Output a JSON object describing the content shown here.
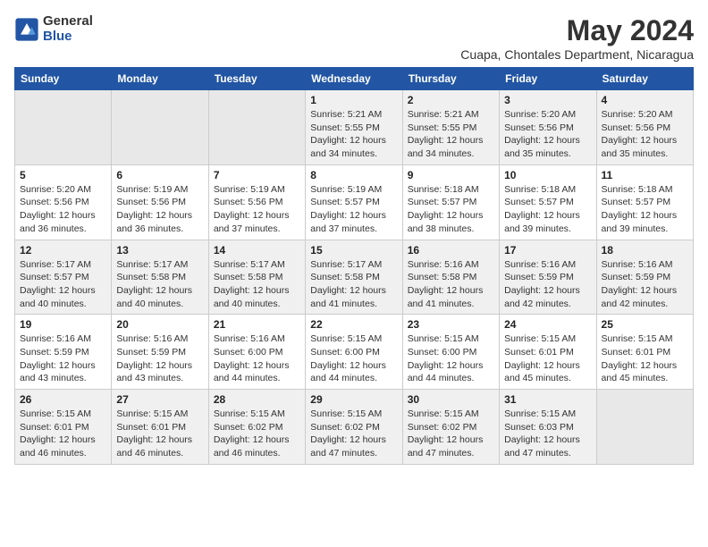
{
  "logo": {
    "general": "General",
    "blue": "Blue"
  },
  "title": "May 2024",
  "subtitle": "Cuapa, Chontales Department, Nicaragua",
  "days_of_week": [
    "Sunday",
    "Monday",
    "Tuesday",
    "Wednesday",
    "Thursday",
    "Friday",
    "Saturday"
  ],
  "weeks": [
    [
      {
        "day": "",
        "empty": true
      },
      {
        "day": "",
        "empty": true
      },
      {
        "day": "",
        "empty": true
      },
      {
        "day": "1",
        "sunrise": "5:21 AM",
        "sunset": "5:55 PM",
        "daylight": "12 hours and 34 minutes."
      },
      {
        "day": "2",
        "sunrise": "5:21 AM",
        "sunset": "5:55 PM",
        "daylight": "12 hours and 34 minutes."
      },
      {
        "day": "3",
        "sunrise": "5:20 AM",
        "sunset": "5:56 PM",
        "daylight": "12 hours and 35 minutes."
      },
      {
        "day": "4",
        "sunrise": "5:20 AM",
        "sunset": "5:56 PM",
        "daylight": "12 hours and 35 minutes."
      }
    ],
    [
      {
        "day": "5",
        "sunrise": "5:20 AM",
        "sunset": "5:56 PM",
        "daylight": "12 hours and 36 minutes."
      },
      {
        "day": "6",
        "sunrise": "5:19 AM",
        "sunset": "5:56 PM",
        "daylight": "12 hours and 36 minutes."
      },
      {
        "day": "7",
        "sunrise": "5:19 AM",
        "sunset": "5:56 PM",
        "daylight": "12 hours and 37 minutes."
      },
      {
        "day": "8",
        "sunrise": "5:19 AM",
        "sunset": "5:57 PM",
        "daylight": "12 hours and 37 minutes."
      },
      {
        "day": "9",
        "sunrise": "5:18 AM",
        "sunset": "5:57 PM",
        "daylight": "12 hours and 38 minutes."
      },
      {
        "day": "10",
        "sunrise": "5:18 AM",
        "sunset": "5:57 PM",
        "daylight": "12 hours and 39 minutes."
      },
      {
        "day": "11",
        "sunrise": "5:18 AM",
        "sunset": "5:57 PM",
        "daylight": "12 hours and 39 minutes."
      }
    ],
    [
      {
        "day": "12",
        "sunrise": "5:17 AM",
        "sunset": "5:57 PM",
        "daylight": "12 hours and 40 minutes."
      },
      {
        "day": "13",
        "sunrise": "5:17 AM",
        "sunset": "5:58 PM",
        "daylight": "12 hours and 40 minutes."
      },
      {
        "day": "14",
        "sunrise": "5:17 AM",
        "sunset": "5:58 PM",
        "daylight": "12 hours and 40 minutes."
      },
      {
        "day": "15",
        "sunrise": "5:17 AM",
        "sunset": "5:58 PM",
        "daylight": "12 hours and 41 minutes."
      },
      {
        "day": "16",
        "sunrise": "5:16 AM",
        "sunset": "5:58 PM",
        "daylight": "12 hours and 41 minutes."
      },
      {
        "day": "17",
        "sunrise": "5:16 AM",
        "sunset": "5:59 PM",
        "daylight": "12 hours and 42 minutes."
      },
      {
        "day": "18",
        "sunrise": "5:16 AM",
        "sunset": "5:59 PM",
        "daylight": "12 hours and 42 minutes."
      }
    ],
    [
      {
        "day": "19",
        "sunrise": "5:16 AM",
        "sunset": "5:59 PM",
        "daylight": "12 hours and 43 minutes."
      },
      {
        "day": "20",
        "sunrise": "5:16 AM",
        "sunset": "5:59 PM",
        "daylight": "12 hours and 43 minutes."
      },
      {
        "day": "21",
        "sunrise": "5:16 AM",
        "sunset": "6:00 PM",
        "daylight": "12 hours and 44 minutes."
      },
      {
        "day": "22",
        "sunrise": "5:15 AM",
        "sunset": "6:00 PM",
        "daylight": "12 hours and 44 minutes."
      },
      {
        "day": "23",
        "sunrise": "5:15 AM",
        "sunset": "6:00 PM",
        "daylight": "12 hours and 44 minutes."
      },
      {
        "day": "24",
        "sunrise": "5:15 AM",
        "sunset": "6:01 PM",
        "daylight": "12 hours and 45 minutes."
      },
      {
        "day": "25",
        "sunrise": "5:15 AM",
        "sunset": "6:01 PM",
        "daylight": "12 hours and 45 minutes."
      }
    ],
    [
      {
        "day": "26",
        "sunrise": "5:15 AM",
        "sunset": "6:01 PM",
        "daylight": "12 hours and 46 minutes."
      },
      {
        "day": "27",
        "sunrise": "5:15 AM",
        "sunset": "6:01 PM",
        "daylight": "12 hours and 46 minutes."
      },
      {
        "day": "28",
        "sunrise": "5:15 AM",
        "sunset": "6:02 PM",
        "daylight": "12 hours and 46 minutes."
      },
      {
        "day": "29",
        "sunrise": "5:15 AM",
        "sunset": "6:02 PM",
        "daylight": "12 hours and 47 minutes."
      },
      {
        "day": "30",
        "sunrise": "5:15 AM",
        "sunset": "6:02 PM",
        "daylight": "12 hours and 47 minutes."
      },
      {
        "day": "31",
        "sunrise": "5:15 AM",
        "sunset": "6:03 PM",
        "daylight": "12 hours and 47 minutes."
      },
      {
        "day": "",
        "empty": true
      }
    ]
  ]
}
